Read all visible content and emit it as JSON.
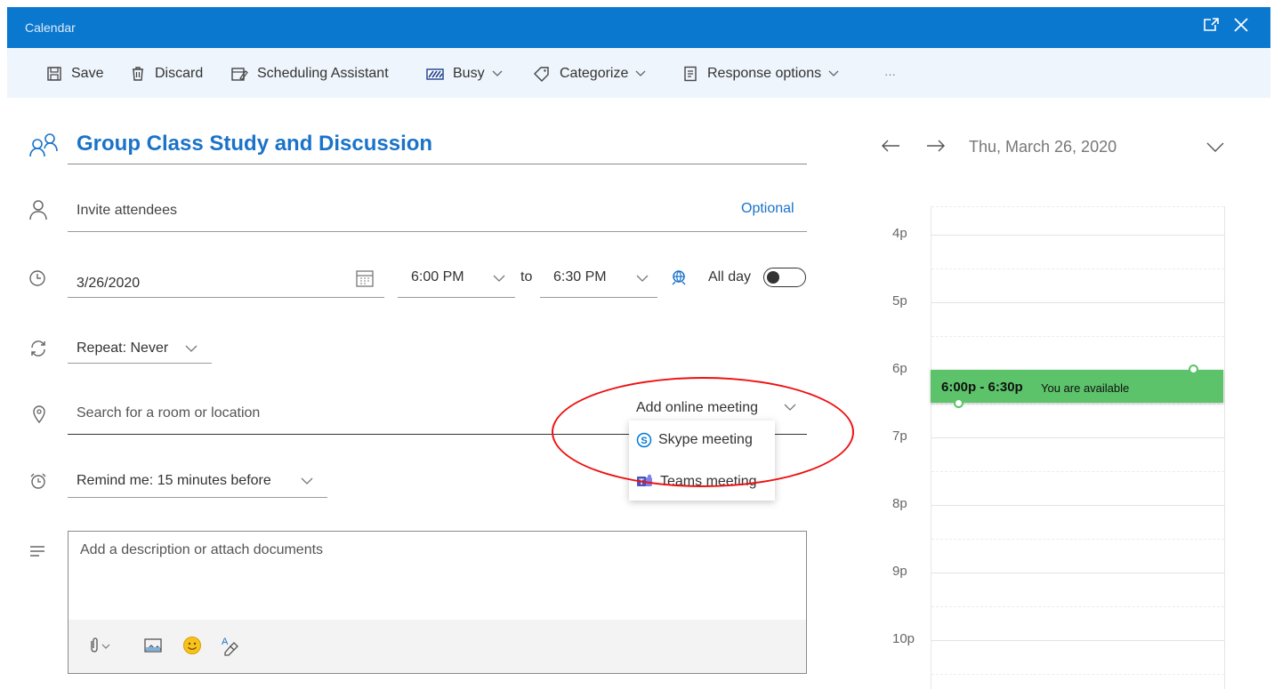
{
  "window": {
    "title": "Calendar"
  },
  "toolbar": {
    "save": "Save",
    "discard": "Discard",
    "scheduling_assistant": "Scheduling Assistant",
    "busy": "Busy",
    "categorize": "Categorize",
    "response_options": "Response options",
    "more": "···"
  },
  "event": {
    "title": "Group Class Study and Discussion",
    "attendees_placeholder": "Invite attendees",
    "optional_link": "Optional",
    "date": "3/26/2020",
    "start_time": "6:00 PM",
    "to_label": "to",
    "end_time": "6:30 PM",
    "all_day_label": "All day",
    "all_day_on": false,
    "repeat": "Repeat: Never",
    "location_placeholder": "Search for a room or location",
    "add_online_meeting": "Add online meeting",
    "online_options": [
      "Skype meeting",
      "Teams meeting"
    ],
    "reminder": "Remind me: 15 minutes before",
    "description_placeholder": "Add a description or attach documents"
  },
  "day_view": {
    "date": "Thu, March 26, 2020",
    "hours": [
      "4p",
      "5p",
      "6p",
      "7p",
      "8p",
      "9p",
      "10p"
    ],
    "event_time": "6:00p - 6:30p",
    "event_status": "You are available"
  },
  "colors": {
    "titlebar": "#0b78d0",
    "toolbar": "#eef5fc",
    "accent_text": "#1a73c8",
    "event_fill": "#5cc36a",
    "annotation": "#e11111"
  }
}
